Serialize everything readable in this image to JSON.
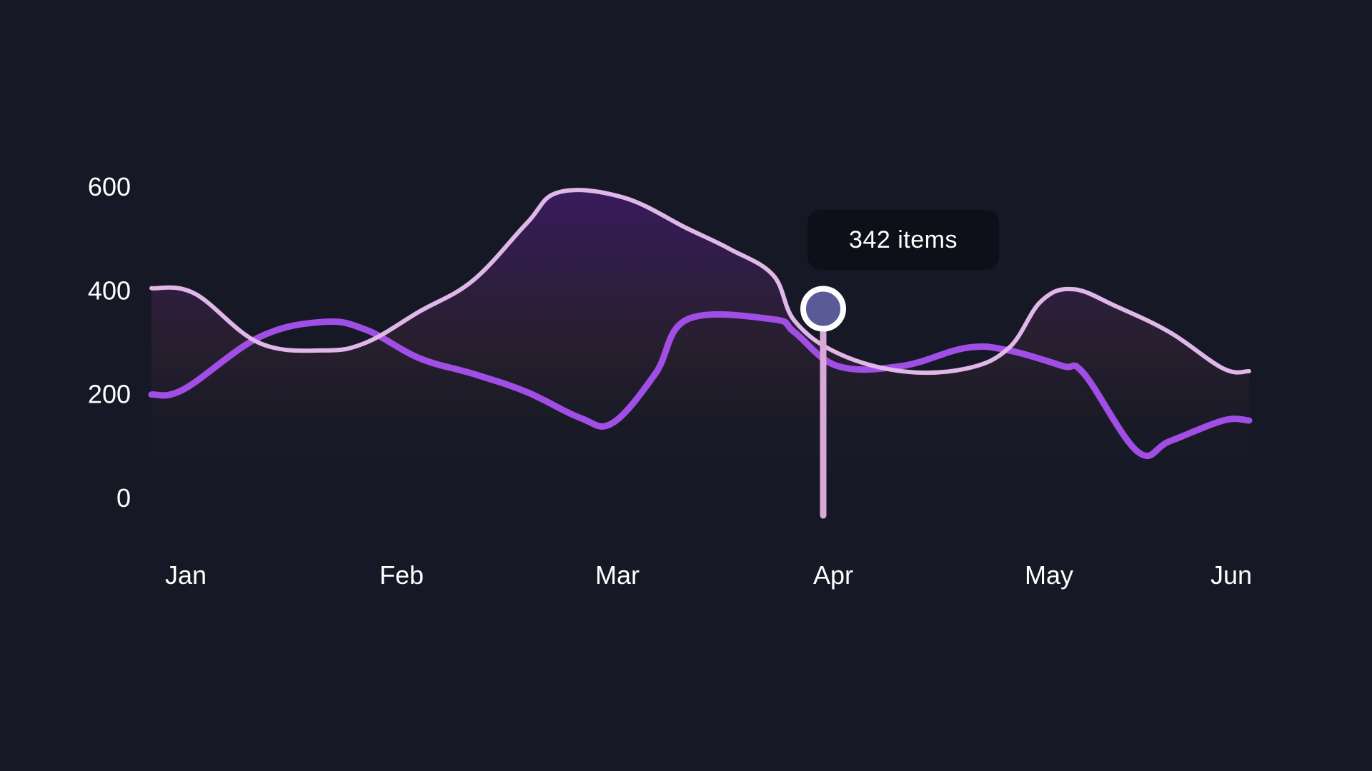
{
  "chart_data": {
    "type": "line",
    "categories": [
      "Jan",
      "Feb",
      "Mar",
      "Apr",
      "May",
      "Jun"
    ],
    "y_ticks": [
      "0",
      "200",
      "400",
      "600"
    ],
    "ylim": [
      0,
      600
    ],
    "grid": false,
    "series": [
      {
        "color": "#e0b8e8",
        "area_fill": true,
        "points": [
          {
            "x": 0.0,
            "y": 405
          },
          {
            "x": 0.2,
            "y": 395
          },
          {
            "x": 0.5,
            "y": 300
          },
          {
            "x": 0.8,
            "y": 285
          },
          {
            "x": 1.0,
            "y": 300
          },
          {
            "x": 1.25,
            "y": 360
          },
          {
            "x": 1.5,
            "y": 420
          },
          {
            "x": 1.75,
            "y": 530
          },
          {
            "x": 1.9,
            "y": 590
          },
          {
            "x": 2.2,
            "y": 580
          },
          {
            "x": 2.5,
            "y": 520
          },
          {
            "x": 2.7,
            "y": 480
          },
          {
            "x": 2.9,
            "y": 430
          },
          {
            "x": 3.0,
            "y": 342
          },
          {
            "x": 3.2,
            "y": 280
          },
          {
            "x": 3.5,
            "y": 245
          },
          {
            "x": 3.8,
            "y": 250
          },
          {
            "x": 4.0,
            "y": 290
          },
          {
            "x": 4.15,
            "y": 380
          },
          {
            "x": 4.3,
            "y": 403
          },
          {
            "x": 4.5,
            "y": 370
          },
          {
            "x": 4.75,
            "y": 320
          },
          {
            "x": 5.0,
            "y": 250
          },
          {
            "x": 5.12,
            "y": 245
          }
        ]
      },
      {
        "color": "#a04ee6",
        "area_fill": false,
        "points": [
          {
            "x": 0.0,
            "y": 200
          },
          {
            "x": 0.15,
            "y": 210
          },
          {
            "x": 0.5,
            "y": 310
          },
          {
            "x": 0.8,
            "y": 340
          },
          {
            "x": 1.0,
            "y": 325
          },
          {
            "x": 1.25,
            "y": 270
          },
          {
            "x": 1.5,
            "y": 240
          },
          {
            "x": 1.75,
            "y": 205
          },
          {
            "x": 2.0,
            "y": 155
          },
          {
            "x": 2.15,
            "y": 145
          },
          {
            "x": 2.35,
            "y": 240
          },
          {
            "x": 2.5,
            "y": 345
          },
          {
            "x": 2.9,
            "y": 345
          },
          {
            "x": 3.0,
            "y": 320
          },
          {
            "x": 3.2,
            "y": 255
          },
          {
            "x": 3.5,
            "y": 255
          },
          {
            "x": 3.8,
            "y": 290
          },
          {
            "x": 4.0,
            "y": 285
          },
          {
            "x": 4.25,
            "y": 255
          },
          {
            "x": 4.35,
            "y": 240
          },
          {
            "x": 4.6,
            "y": 90
          },
          {
            "x": 4.75,
            "y": 110
          },
          {
            "x": 5.0,
            "y": 150
          },
          {
            "x": 5.12,
            "y": 150
          }
        ]
      }
    ],
    "highlight": {
      "category": "Apr",
      "value": 342,
      "label": "342 items"
    }
  }
}
